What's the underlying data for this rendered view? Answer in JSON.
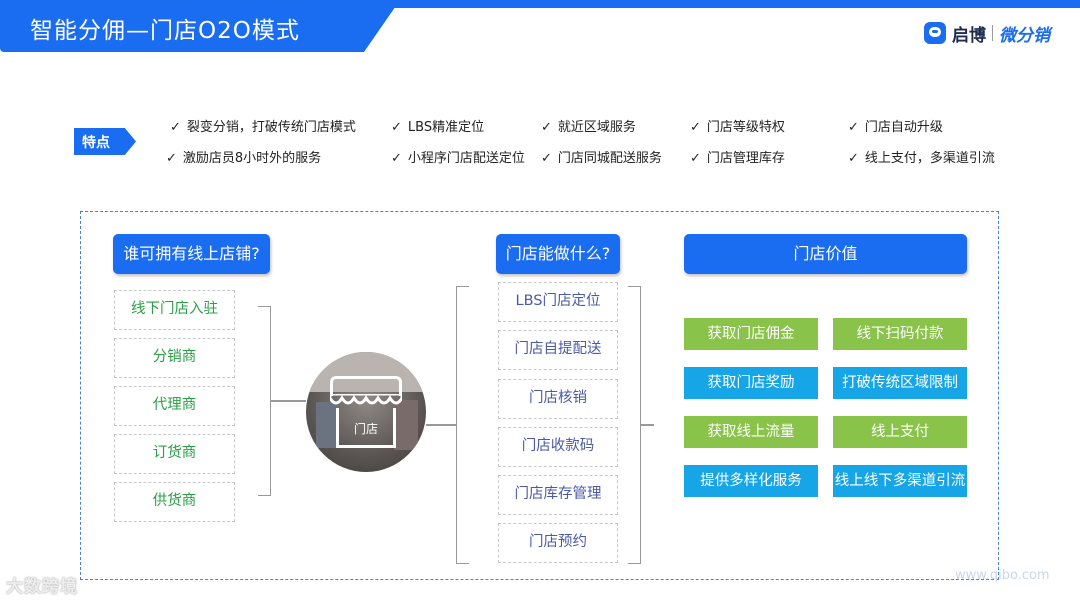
{
  "header": {
    "title": "智能分佣—门店O2O模式",
    "logo": {
      "name": "启博",
      "product": "微分销"
    }
  },
  "features": {
    "tag": "特点",
    "check_icon": "✓",
    "items": [
      "裂变分销，打破传统门店模式",
      "LBS精准定位",
      "就近区域服务",
      "门店等级特权",
      "门店自动升级",
      "激励店员8小时外的服务",
      "小程序门店配送定位",
      "门店同城配送服务",
      "门店管理库存",
      "线上支付，多渠道引流"
    ]
  },
  "who": {
    "heading": "谁可拥有线上店铺?",
    "items": [
      "线下门店入驻",
      "分销商",
      "代理商",
      "订货商",
      "供货商"
    ]
  },
  "store": {
    "label": "门店"
  },
  "what": {
    "heading": "门店能做什么?",
    "items": [
      "LBS门店定位",
      "门店自提配送",
      "门店核销",
      "门店收款码",
      "门店库存管理",
      "门店预约"
    ]
  },
  "value": {
    "heading": "门店价值",
    "items": [
      {
        "label": "获取门店佣金",
        "color": "#8ac34a"
      },
      {
        "label": "线下扫码付款",
        "color": "#8ac34a"
      },
      {
        "label": "获取门店奖励",
        "color": "#16a6e8"
      },
      {
        "label": "打破传统区域限制",
        "color": "#16a6e8"
      },
      {
        "label": "获取线上流量",
        "color": "#8ac34a"
      },
      {
        "label": "线上支付",
        "color": "#8ac34a"
      },
      {
        "label": "提供多样化服务",
        "color": "#16a6e8"
      },
      {
        "label": "线上线下多渠道引流",
        "color": "#16a6e8"
      }
    ]
  },
  "watermarks": {
    "left": "大数跨境",
    "right": "www.qibo.com"
  },
  "colors": {
    "primary": "#1a6cf0",
    "green": "#8ac34a",
    "cyan": "#16a6e8",
    "who_text": "#2aa047",
    "what_text": "#4b5aa8"
  }
}
